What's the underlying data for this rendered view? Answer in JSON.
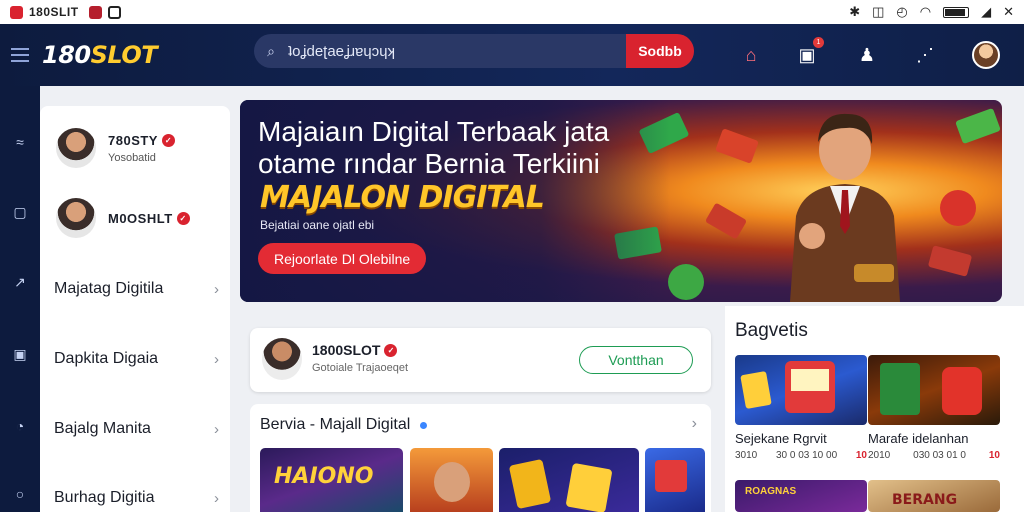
{
  "status": {
    "app_title": "180SLIT",
    "icons": [
      "bluetooth-icon",
      "vibrate-icon",
      "alarm-icon",
      "wifi-icon",
      "battery-icon",
      "signal-icon",
      "close-icon"
    ],
    "battery_level": 0.85
  },
  "header": {
    "logo_main": "180",
    "logo_accent": "SLOT",
    "search_placeholder": "ʇoʝdeʈaeʝɹɐɥɔɥʞ",
    "search_value": "ʇoʝdeʈaeʝɹɐɥɔɥʞ",
    "search_button": "Sodbb",
    "notification_count": "1"
  },
  "sidebar": {
    "users": [
      {
        "name": "780STY",
        "sub": "Yosobatid"
      },
      {
        "name": "M0OSHLT",
        "sub": ""
      }
    ],
    "items": [
      {
        "label": "Majatag Digitila"
      },
      {
        "label": "Dapkita Digaia"
      },
      {
        "label": "Bajalg Manita"
      },
      {
        "label": "Burhag Digitia"
      }
    ]
  },
  "hero": {
    "line1": "Majaiaın Digital Terbaak jata",
    "line2": "otame rındar Bernia Terkiini",
    "gold": "MAJALON DIGITAL",
    "subline": "Bejatiai oane ojatl ebi",
    "cta": "Rejoorlate Dl Olebilne"
  },
  "profile_card": {
    "name": "1800SLOT",
    "sub": "Gotoiale Trajaoeqet",
    "follow": "Vontthan"
  },
  "feed": {
    "title": "Bervia - Majall Digital",
    "thumb_text": "HAIONO"
  },
  "right_panel": {
    "title": "Bagvetis",
    "cards": [
      {
        "name": "Sejekane Rgrvit",
        "count": "3010",
        "meta": "30 0 03 10 00",
        "rating": "10"
      },
      {
        "name": "Marafe idelanhan",
        "count": "2010",
        "meta": "030 03 01 0",
        "rating": "10"
      }
    ],
    "card_labels": [
      "ROAGNAS",
      "BERANG"
    ]
  }
}
